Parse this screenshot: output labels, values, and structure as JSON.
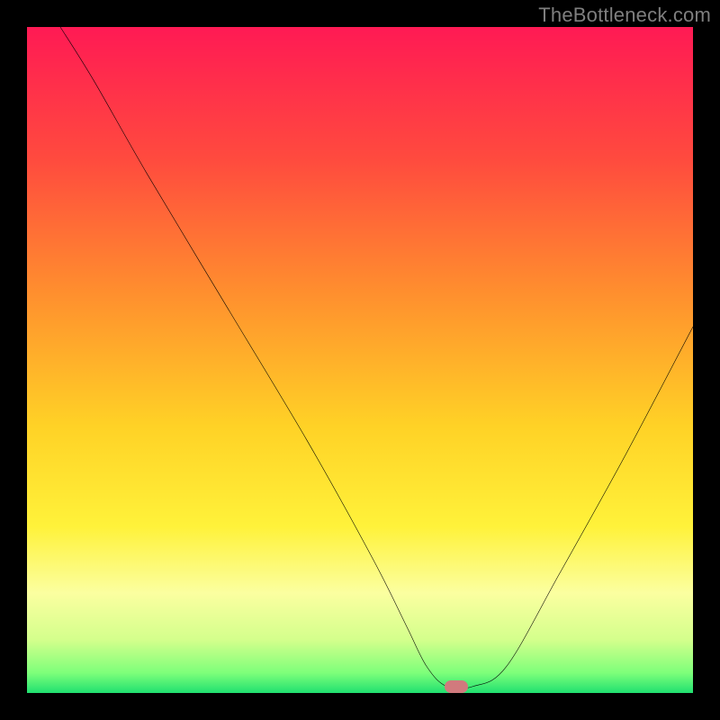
{
  "watermark": "TheBottleneck.com",
  "colors": {
    "frame_bg": "#000000",
    "watermark": "#7f7f7f",
    "curve": "#000000",
    "marker": "#d17a7d",
    "gradient_stops": [
      {
        "offset": 0.0,
        "color": "#ff1a54"
      },
      {
        "offset": 0.2,
        "color": "#ff4b3e"
      },
      {
        "offset": 0.4,
        "color": "#ff8f2e"
      },
      {
        "offset": 0.6,
        "color": "#ffd226"
      },
      {
        "offset": 0.75,
        "color": "#fff23a"
      },
      {
        "offset": 0.85,
        "color": "#fbffa0"
      },
      {
        "offset": 0.92,
        "color": "#d4ff8c"
      },
      {
        "offset": 0.97,
        "color": "#7dff7a"
      },
      {
        "offset": 1.0,
        "color": "#20e070"
      }
    ]
  },
  "chart_data": {
    "type": "line",
    "title": "",
    "xlabel": "",
    "ylabel": "",
    "xlim": [
      0,
      100
    ],
    "ylim": [
      0,
      100
    ],
    "series": [
      {
        "name": "bottleneck-curve",
        "x": [
          5,
          10,
          18,
          30,
          42,
          52,
          57,
          60,
          63,
          67,
          72,
          80,
          90,
          100
        ],
        "y": [
          100,
          92,
          78,
          58,
          38,
          20,
          10,
          4,
          1,
          1,
          4,
          18,
          36,
          55
        ]
      }
    ],
    "marker_fraction_x": 0.645,
    "marker_fraction_y": 0.99
  }
}
